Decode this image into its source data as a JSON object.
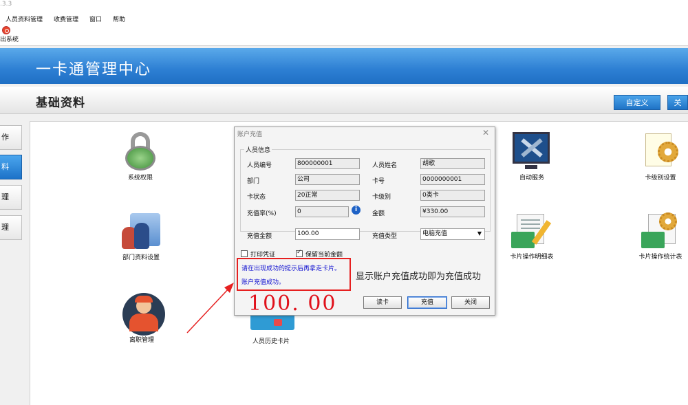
{
  "window": {
    "title_fragment": ".3.3"
  },
  "menu": {
    "items": [
      "人员资料管理",
      "收费管理",
      "窗口",
      "帮助"
    ]
  },
  "toolbar": {
    "exit_label": "出系统"
  },
  "banner": {
    "title": "一卡通管理中心"
  },
  "section": {
    "title": "基础资料",
    "custom_button": "自定义",
    "close_button": "关"
  },
  "sidebar": {
    "tabs": [
      "作",
      "料",
      "理",
      "理"
    ]
  },
  "modules": {
    "system_perm": "系统权限",
    "dept_setting": "部门资料设置",
    "leave_mgmt": "离职管理",
    "card_history": "人员历史卡片",
    "auto_service": "自动服务",
    "card_level": "卡级别设置",
    "card_detail": "卡片操作明细表",
    "card_stat": "卡片操作统计表"
  },
  "dialog": {
    "title": "账户充值",
    "group_label": "人员信息",
    "fields": {
      "emp_no_label": "人员编号",
      "emp_no": "800000001",
      "emp_name_label": "人员姓名",
      "emp_name": "胡歌",
      "dept_label": "部门",
      "dept": "公司",
      "card_no_label": "卡号",
      "card_no": "0000000001",
      "card_status_label": "卡状态",
      "card_status": "20正常",
      "card_level_label": "卡级别",
      "card_level": "0类卡",
      "rate_label": "充值率(%)",
      "rate": "0",
      "balance_label": "金额",
      "balance": "¥330.00",
      "amount_label": "充值金额",
      "amount": "100.00",
      "type_label": "充值类型",
      "type": "电脑充值"
    },
    "print_voucher": "打印凭证",
    "keep_amount": "保留当前金额",
    "status_line1": "请在出现成功的提示后再拿走卡片。",
    "status_line2": "账户充值成功。",
    "big_amount": "100. 00",
    "read_card": "读卡",
    "recharge": "充值",
    "close": "关闭"
  },
  "annotation": "显示账户充值成功即为充值成功",
  "colors": {
    "banner": "#2d7fd3",
    "highlight_red": "#e62020",
    "status_blue": "#1010d0"
  }
}
